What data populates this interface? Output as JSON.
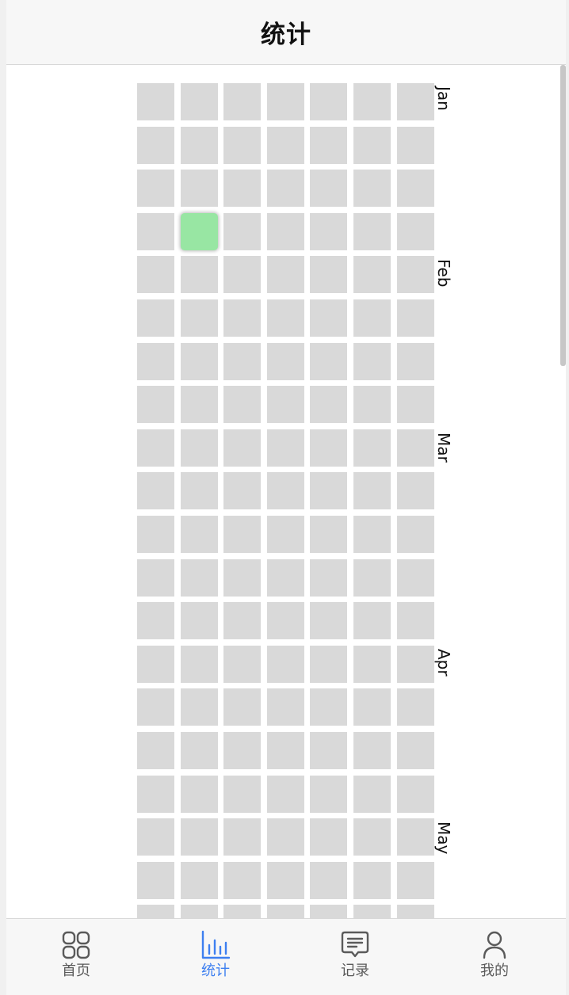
{
  "header": {
    "title": "统计"
  },
  "calendar": {
    "columns": 7,
    "rows": 20,
    "active_cells": [
      {
        "row": 3,
        "col": 1
      }
    ],
    "cell_color": "#d9d9d9",
    "active_color": "#98e6a3",
    "months": [
      {
        "label": "Jan",
        "row": 0
      },
      {
        "label": "Feb",
        "row": 4
      },
      {
        "label": "Mar",
        "row": 8
      },
      {
        "label": "Apr",
        "row": 13
      },
      {
        "label": "May",
        "row": 17
      }
    ]
  },
  "tabbar": {
    "accent_color": "#3d7ff0",
    "tabs": [
      {
        "label": "首页",
        "icon": "grid-icon",
        "selected": false
      },
      {
        "label": "统计",
        "icon": "bar-chart-icon",
        "selected": true
      },
      {
        "label": "记录",
        "icon": "message-icon",
        "selected": false
      },
      {
        "label": "我的",
        "icon": "user-icon",
        "selected": false
      }
    ]
  }
}
